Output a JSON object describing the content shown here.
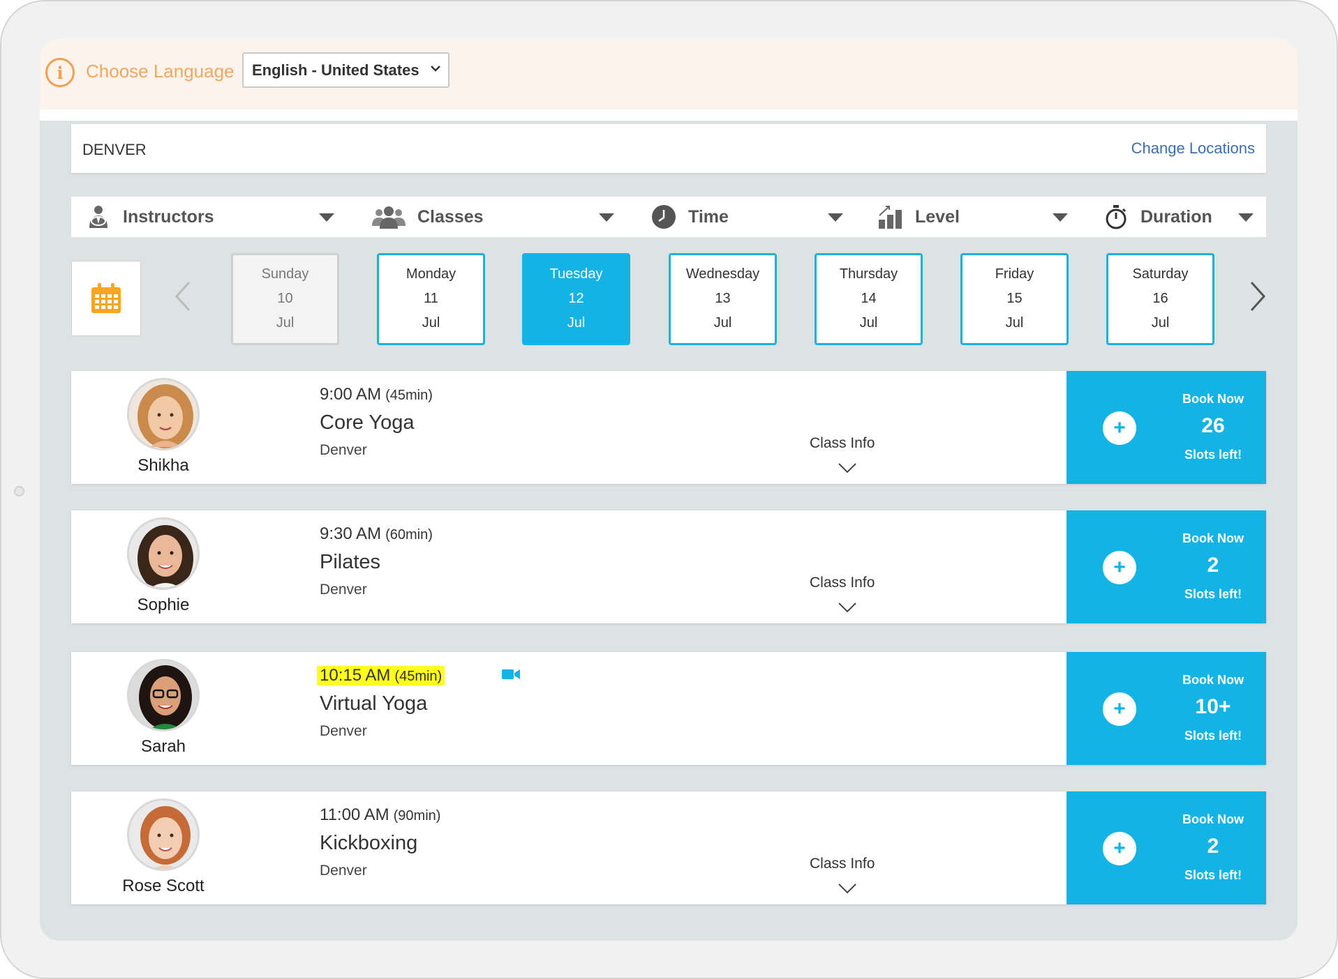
{
  "language": {
    "label": "Choose Language",
    "selected": "English - United States"
  },
  "location": {
    "name": "DENVER",
    "change_label": "Change Locations"
  },
  "filters": [
    {
      "label": "Instructors",
      "icon": "instructor-icon"
    },
    {
      "label": "Classes",
      "icon": "group-icon"
    },
    {
      "label": "Time",
      "icon": "clock-icon"
    },
    {
      "label": "Level",
      "icon": "level-icon"
    },
    {
      "label": "Duration",
      "icon": "stopwatch-icon"
    }
  ],
  "days": [
    {
      "name": "Sunday",
      "date": "10",
      "month": "Jul",
      "state": "past"
    },
    {
      "name": "Monday",
      "date": "11",
      "month": "Jul",
      "state": "available"
    },
    {
      "name": "Tuesday",
      "date": "12",
      "month": "Jul",
      "state": "selected"
    },
    {
      "name": "Wednesday",
      "date": "13",
      "month": "Jul",
      "state": "available"
    },
    {
      "name": "Thursday",
      "date": "14",
      "month": "Jul",
      "state": "available"
    },
    {
      "name": "Friday",
      "date": "15",
      "month": "Jul",
      "state": "available"
    },
    {
      "name": "Saturday",
      "date": "16",
      "month": "Jul",
      "state": "available"
    }
  ],
  "classes": [
    {
      "instructor": "Shikha",
      "time": "9:00 AM",
      "duration": "(45min)",
      "name": "Core Yoga",
      "location": "Denver",
      "info_label": "Class Info",
      "book_label": "Book Now",
      "slots": "26",
      "slots_label": "Slots left!",
      "virtual": false
    },
    {
      "instructor": "Sophie",
      "time": "9:30 AM",
      "duration": "(60min)",
      "name": "Pilates",
      "location": "Denver",
      "info_label": "Class Info",
      "book_label": "Book Now",
      "slots": "2",
      "slots_label": "Slots left!",
      "virtual": false
    },
    {
      "instructor": "Sarah",
      "time": "10:15 AM",
      "duration": "(45min)",
      "name": "Virtual Yoga",
      "location": "Denver",
      "info_label": "",
      "book_label": "Book Now",
      "slots": "10+",
      "slots_label": "Slots left!",
      "virtual": true
    },
    {
      "instructor": "Rose Scott",
      "time": "11:00 AM",
      "duration": "(90min)",
      "name": "Kickboxing",
      "location": "Denver",
      "info_label": "Class Info",
      "book_label": "Book Now",
      "slots": "2",
      "slots_label": "Slots left!",
      "virtual": false
    }
  ],
  "colors": {
    "accent": "#13b3e6",
    "warning": "#f0a050",
    "highlight": "#ffff1e",
    "link": "#3a6fb0"
  }
}
